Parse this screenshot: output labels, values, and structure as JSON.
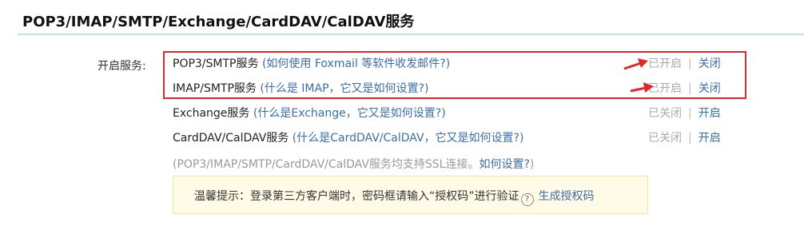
{
  "section": {
    "title": "POP3/IMAP/SMTP/Exchange/CardDAV/CalDAV服务"
  },
  "enable_label": "开启服务:",
  "services": [
    {
      "name": "POP3/SMTP服务",
      "open_paren": " (",
      "help": "如何使用 Foxmail 等软件收发邮件?",
      "close_paren": ")",
      "state": "已开启",
      "action": "关闭"
    },
    {
      "name": "IMAP/SMTP服务",
      "open_paren": " (",
      "help": "什么是 IMAP，它又是如何设置?",
      "close_paren": ")",
      "state": "已开启",
      "action": "关闭"
    },
    {
      "name": "Exchange服务",
      "open_paren": " (",
      "help": "什么是Exchange，它又是如何设置?",
      "close_paren": ")",
      "state": "已关闭",
      "action": "开启"
    },
    {
      "name": "CardDAV/CalDAV服务",
      "open_paren": " (",
      "help": "什么是CardDAV/CalDAV，它又是如何设置?",
      "close_paren": ")",
      "state": "已关闭",
      "action": "开启"
    }
  ],
  "status_separator": "|",
  "ssl_note": {
    "text": "(POP3/IMAP/SMTP/CardDAV/CalDAV服务均支持SSL连接。",
    "link": "如何设置?",
    "close": ")"
  },
  "tip": {
    "text": "温馨提示：登录第三方客户端时，密码框请输入“授权码”进行验证",
    "help_icon": "question-circle-icon",
    "help_glyph": "?",
    "link": "生成授权码"
  },
  "colors": {
    "highlight_border": "#e0272a",
    "arrow": "#e0272a",
    "link": "#3b6ea8",
    "tip_bg": "#fffbe6"
  }
}
